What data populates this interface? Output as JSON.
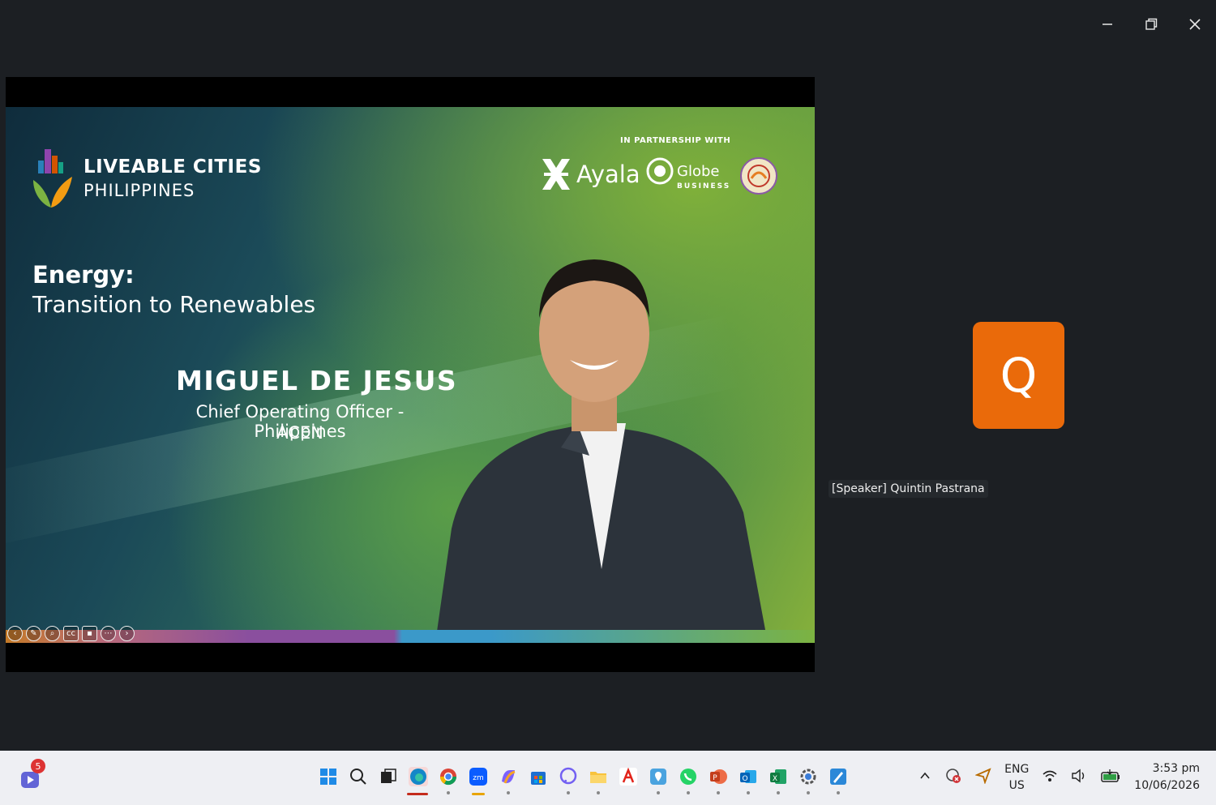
{
  "window": {
    "minimize_icon": "minimize-icon",
    "restore_icon": "restore-icon",
    "close_icon": "close-icon"
  },
  "slide": {
    "logo": {
      "line1": "LIVEABLE CITIES",
      "line2": "PHILIPPINES"
    },
    "partnership_label": "IN PARTNERSHIP WITH",
    "partners": {
      "ayala": "Ayala",
      "globe": "Globe",
      "globe_sub": "BUSINESS"
    },
    "topic_title": "Energy:",
    "topic_subtitle": "Transition to Renewables",
    "speaker_name": "MIGUEL DE JESUS",
    "speaker_role": "Chief Operating Officer - Philippines",
    "speaker_org": "ACEN",
    "tools": [
      "previous-icon",
      "pen-icon",
      "zoom-icon",
      "captions-icon",
      "video-icon",
      "more-icon",
      "next-icon"
    ]
  },
  "participant": {
    "initial": "Q",
    "name": "[Speaker] Quintin Pastrana"
  },
  "taskbar": {
    "teams_badge": "5",
    "apps": [
      "windows-start-icon",
      "search-icon",
      "task-view-icon",
      "edge-icon",
      "chrome-icon",
      "zoom-icon",
      "copilot-icon",
      "store-icon",
      "viber-icon",
      "file-explorer-icon",
      "acrobat-icon",
      "maps-icon",
      "whatsapp-icon",
      "powerpoint-icon",
      "outlook-icon",
      "excel-icon",
      "settings-icon",
      "paint-icon"
    ],
    "lang_line1": "ENG",
    "lang_line2": "US",
    "time": "3:53 pm",
    "date": "10/06/2026"
  }
}
